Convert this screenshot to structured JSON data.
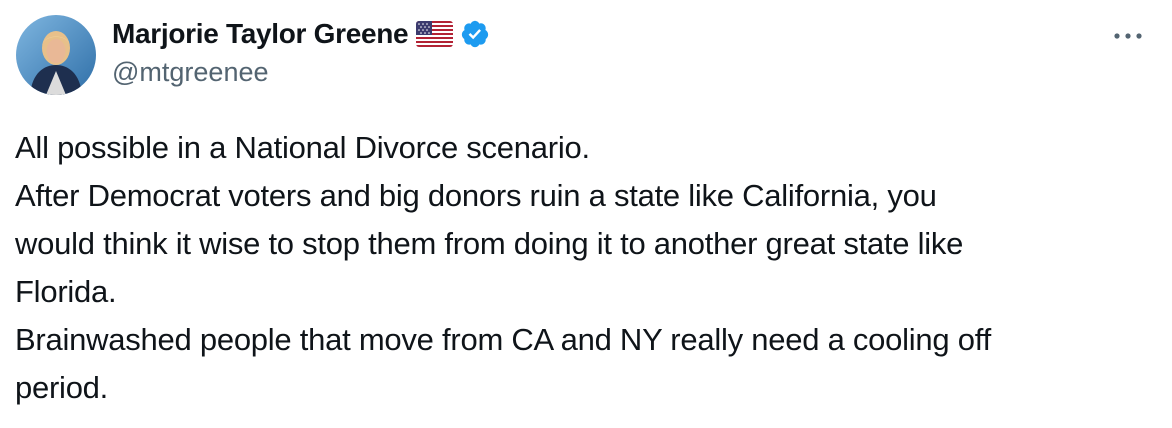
{
  "author": {
    "display_name": "Marjorie Taylor Greene",
    "handle": "@mtgreenee",
    "flag_emoji_name": "us-flag-icon",
    "verified_badge_icon": "verified-check-icon",
    "verified_color": "#1d9bf0"
  },
  "menu": {
    "more_icon": "more-options-icon"
  },
  "tweet": {
    "lines": [
      "All possible in a National Divorce scenario.",
      "After Democrat voters and big donors ruin a state like California, you",
      "would think it wise to stop them from doing it to another great state like",
      "Florida.",
      "Brainwashed people that move from CA and NY really need a cooling off",
      "period."
    ]
  },
  "colors": {
    "text_primary": "#0f1419",
    "text_secondary": "#536471",
    "background": "#ffffff"
  }
}
